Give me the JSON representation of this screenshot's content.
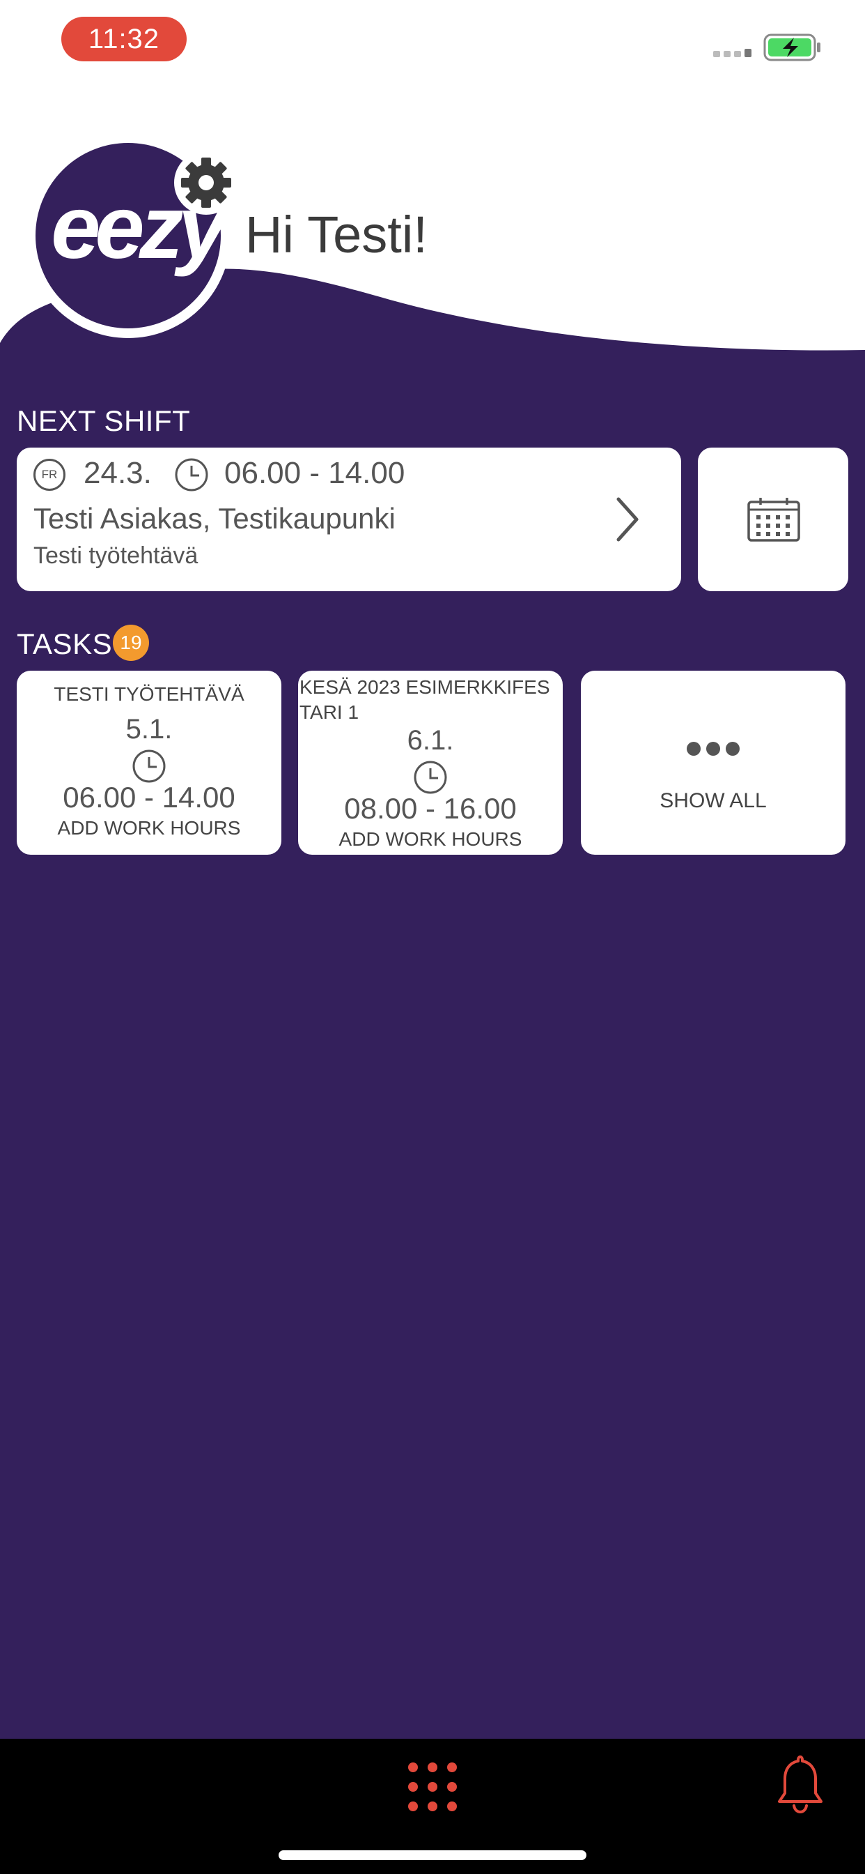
{
  "status_bar": {
    "time": "11:32"
  },
  "header": {
    "logo_text": "eezy",
    "greeting": "Hi Testi!"
  },
  "next_shift": {
    "label": "NEXT SHIFT",
    "weekday": "FR",
    "date": "24.3.",
    "time": "06.00 - 14.00",
    "customer": "Testi Asiakas, Testikaupunki",
    "task": "Testi työtehtävä"
  },
  "tasks": {
    "label": "TASKS",
    "count": "19",
    "items": [
      {
        "title": "TESTI TYÖTEHTÄVÄ",
        "date": "5.1.",
        "time": "06.00 - 14.00",
        "action": "ADD WORK HOURS"
      },
      {
        "title": "KESÄ 2023 ESIMERKKIFESTARI 1",
        "date": "6.1.",
        "time": "08.00 - 16.00",
        "action": "ADD WORK HOURS"
      }
    ],
    "show_all": "SHOW ALL"
  },
  "colors": {
    "background": "#34205c",
    "status_time_bg": "#e2493b",
    "badge": "#f39a2e",
    "bottom_icons": "#e2493b"
  }
}
